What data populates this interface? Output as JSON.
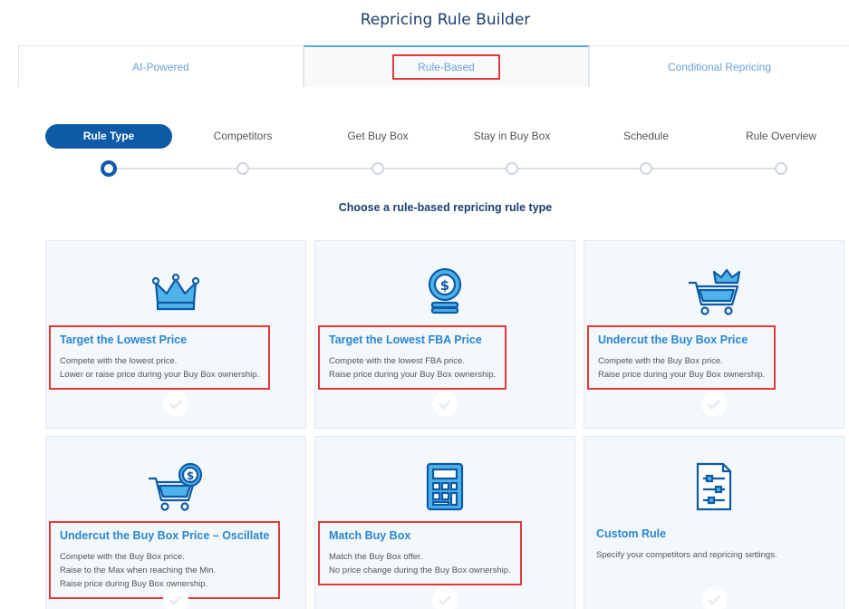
{
  "page_title": "Repricing Rule Builder",
  "tabs": [
    {
      "label": "AI-Powered"
    },
    {
      "label": "Rule-Based"
    },
    {
      "label": "Conditional Repricing"
    }
  ],
  "steps": [
    {
      "label": "Rule Type"
    },
    {
      "label": "Competitors"
    },
    {
      "label": "Get Buy Box"
    },
    {
      "label": "Stay in Buy Box"
    },
    {
      "label": "Schedule"
    },
    {
      "label": "Rule Overview"
    }
  ],
  "subtitle": "Choose a rule-based repricing rule type",
  "cards": [
    {
      "title": "Target the Lowest Price",
      "lines": [
        "Compete with the lowest price.",
        "Lower or raise price during your Buy Box ownership.",
        ""
      ],
      "icon": "crown-icon"
    },
    {
      "title": "Target the Lowest FBA Price",
      "lines": [
        "Compete with the lowest FBA price.",
        "Raise price during your Buy Box ownership.",
        ""
      ],
      "icon": "coin-stack-icon"
    },
    {
      "title": "Undercut the Buy Box Price",
      "lines": [
        "Compete with the Buy Box price.",
        "Raise price during your Buy Box ownership.",
        ""
      ],
      "icon": "cart-crown-icon"
    },
    {
      "title": "Undercut the Buy Box Price – Oscillate",
      "lines": [
        "Compete with the Buy Box price.",
        "Raise to the Max when reaching the Min.",
        "Raise price during Buy Box ownership."
      ],
      "icon": "cart-coin-icon"
    },
    {
      "title": "Match Buy Box",
      "lines": [
        "Match the Buy Box offer.",
        "No price change during the Buy Box ownership.",
        ""
      ],
      "icon": "calculator-icon"
    },
    {
      "title": "Custom Rule",
      "lines": [
        "Specify your competitors and repricing settings.",
        "",
        ""
      ],
      "icon": "settings-document-icon"
    }
  ],
  "colors": {
    "accent": "#0d5aa6",
    "title": "#1b3f6e",
    "card_title": "#2a86cf",
    "highlight": "#e23a3a"
  }
}
